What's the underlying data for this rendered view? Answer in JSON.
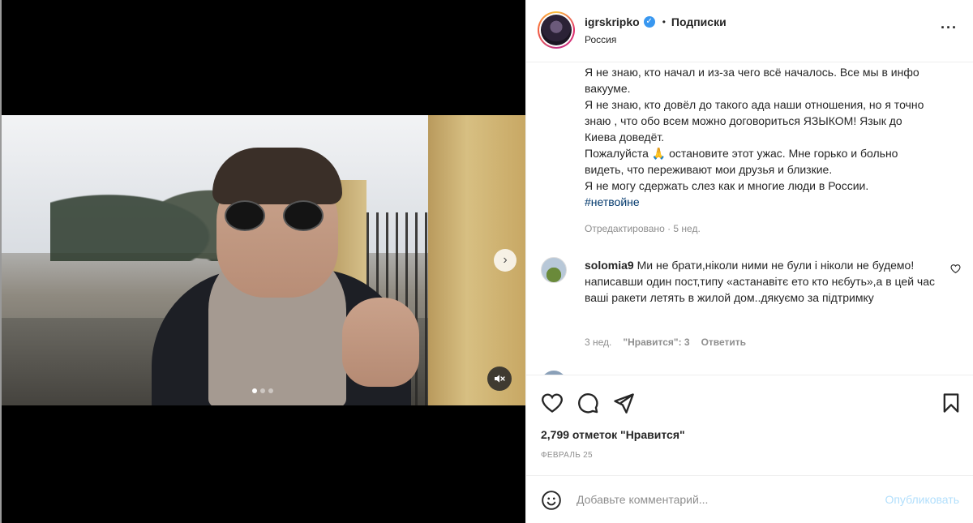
{
  "post": {
    "username": "igrskripko",
    "follow_status": "Подписки",
    "location": "Россия",
    "caption_lines": [
      "Я не знаю, кто начал и из-за чего всё началось. Все мы в инфо вакууме.",
      "Я не знаю, кто довёл до такого ада наши отношения, но я точно знаю , что обо всем можно договориться ЯЗЫКОМ! Язык до Киева доведёт.",
      "Пожалуйста 🙏 остановите этот ужас. Мне горько и больно видеть, что переживают мои друзья и близкие.",
      "Я не могу сдержать слез как и многие люди в России."
    ],
    "hashtag": "#нетвойне",
    "edited_meta": "Отредактировано · 5 нед.",
    "likes": "2,799 отметок \"Нравится\"",
    "date": "Февраль 25"
  },
  "comment": {
    "username": "solomia9",
    "text": "Ми не брати,ніколи ними не були і ніколи не будемо!написавши один пост,типу «астанавітє ето кто нєбуть»,а в цей час ваші ракети летять в жилой дом..дякуємо за підтримку",
    "age": "3 нед.",
    "likes": "\"Нравится\": 3",
    "reply": "Ответить"
  },
  "add_comment": {
    "placeholder": "Добавьте комментарий...",
    "publish": "Опубликовать"
  },
  "media": {
    "carousel_total": 3,
    "carousel_active": 1
  },
  "colors": {
    "link": "#00376b",
    "muted": "#8e8e8e",
    "publish_disabled": "#b2dffc",
    "verified": "#3897f0"
  }
}
